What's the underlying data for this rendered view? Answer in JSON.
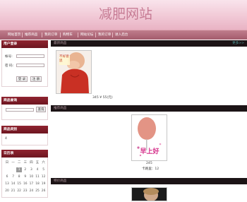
{
  "header": {
    "title": "减肥网站"
  },
  "nav": {
    "items": [
      {
        "label": "网站首页"
      },
      {
        "label": "推荐商品"
      },
      {
        "label": "我的订单"
      },
      {
        "label": "购物车"
      },
      {
        "label": "网站论坛"
      },
      {
        "label": "我的订单"
      },
      {
        "label": "进入后台"
      }
    ]
  },
  "login": {
    "title": "用户登录",
    "username_label": "帐号:",
    "password_label": "密 码:",
    "login_button": "登 录",
    "register_button": "注 册"
  },
  "search": {
    "title": "商品查询",
    "button": "查询"
  },
  "categories": {
    "title": "商品类别",
    "count": "4"
  },
  "calendar": {
    "title": "日历表",
    "weekdays": [
      "日",
      "一",
      "二",
      "三",
      "四",
      "五",
      "六"
    ],
    "rows": [
      [
        "",
        "",
        "1",
        "2",
        "3",
        "4",
        "5"
      ],
      [
        "6",
        "7",
        "8",
        "9",
        "10",
        "11",
        "12"
      ],
      [
        "13",
        "14",
        "15",
        "16",
        "17",
        "18",
        "19"
      ],
      [
        "20",
        "21",
        "22",
        "23",
        "24",
        "25",
        "26"
      ]
    ],
    "today": "1"
  },
  "sections": [
    {
      "title": "最新商品",
      "more": "更多>>"
    },
    {
      "title": "推荐商品"
    },
    {
      "title": "特价商品"
    }
  ],
  "products": [
    {
      "badge": "不好意思",
      "caption": "345 ¥ 55(元)"
    },
    {
      "badge": "早上好",
      "caption1": "245",
      "caption2": "卡路里：12"
    }
  ],
  "colors": {
    "header_pink": "#f1c9d6",
    "nav": "#a35b6c",
    "panel_head": "#7d1c27",
    "section_bar": "#1c1416",
    "accent_link": "#4f9e9e"
  }
}
